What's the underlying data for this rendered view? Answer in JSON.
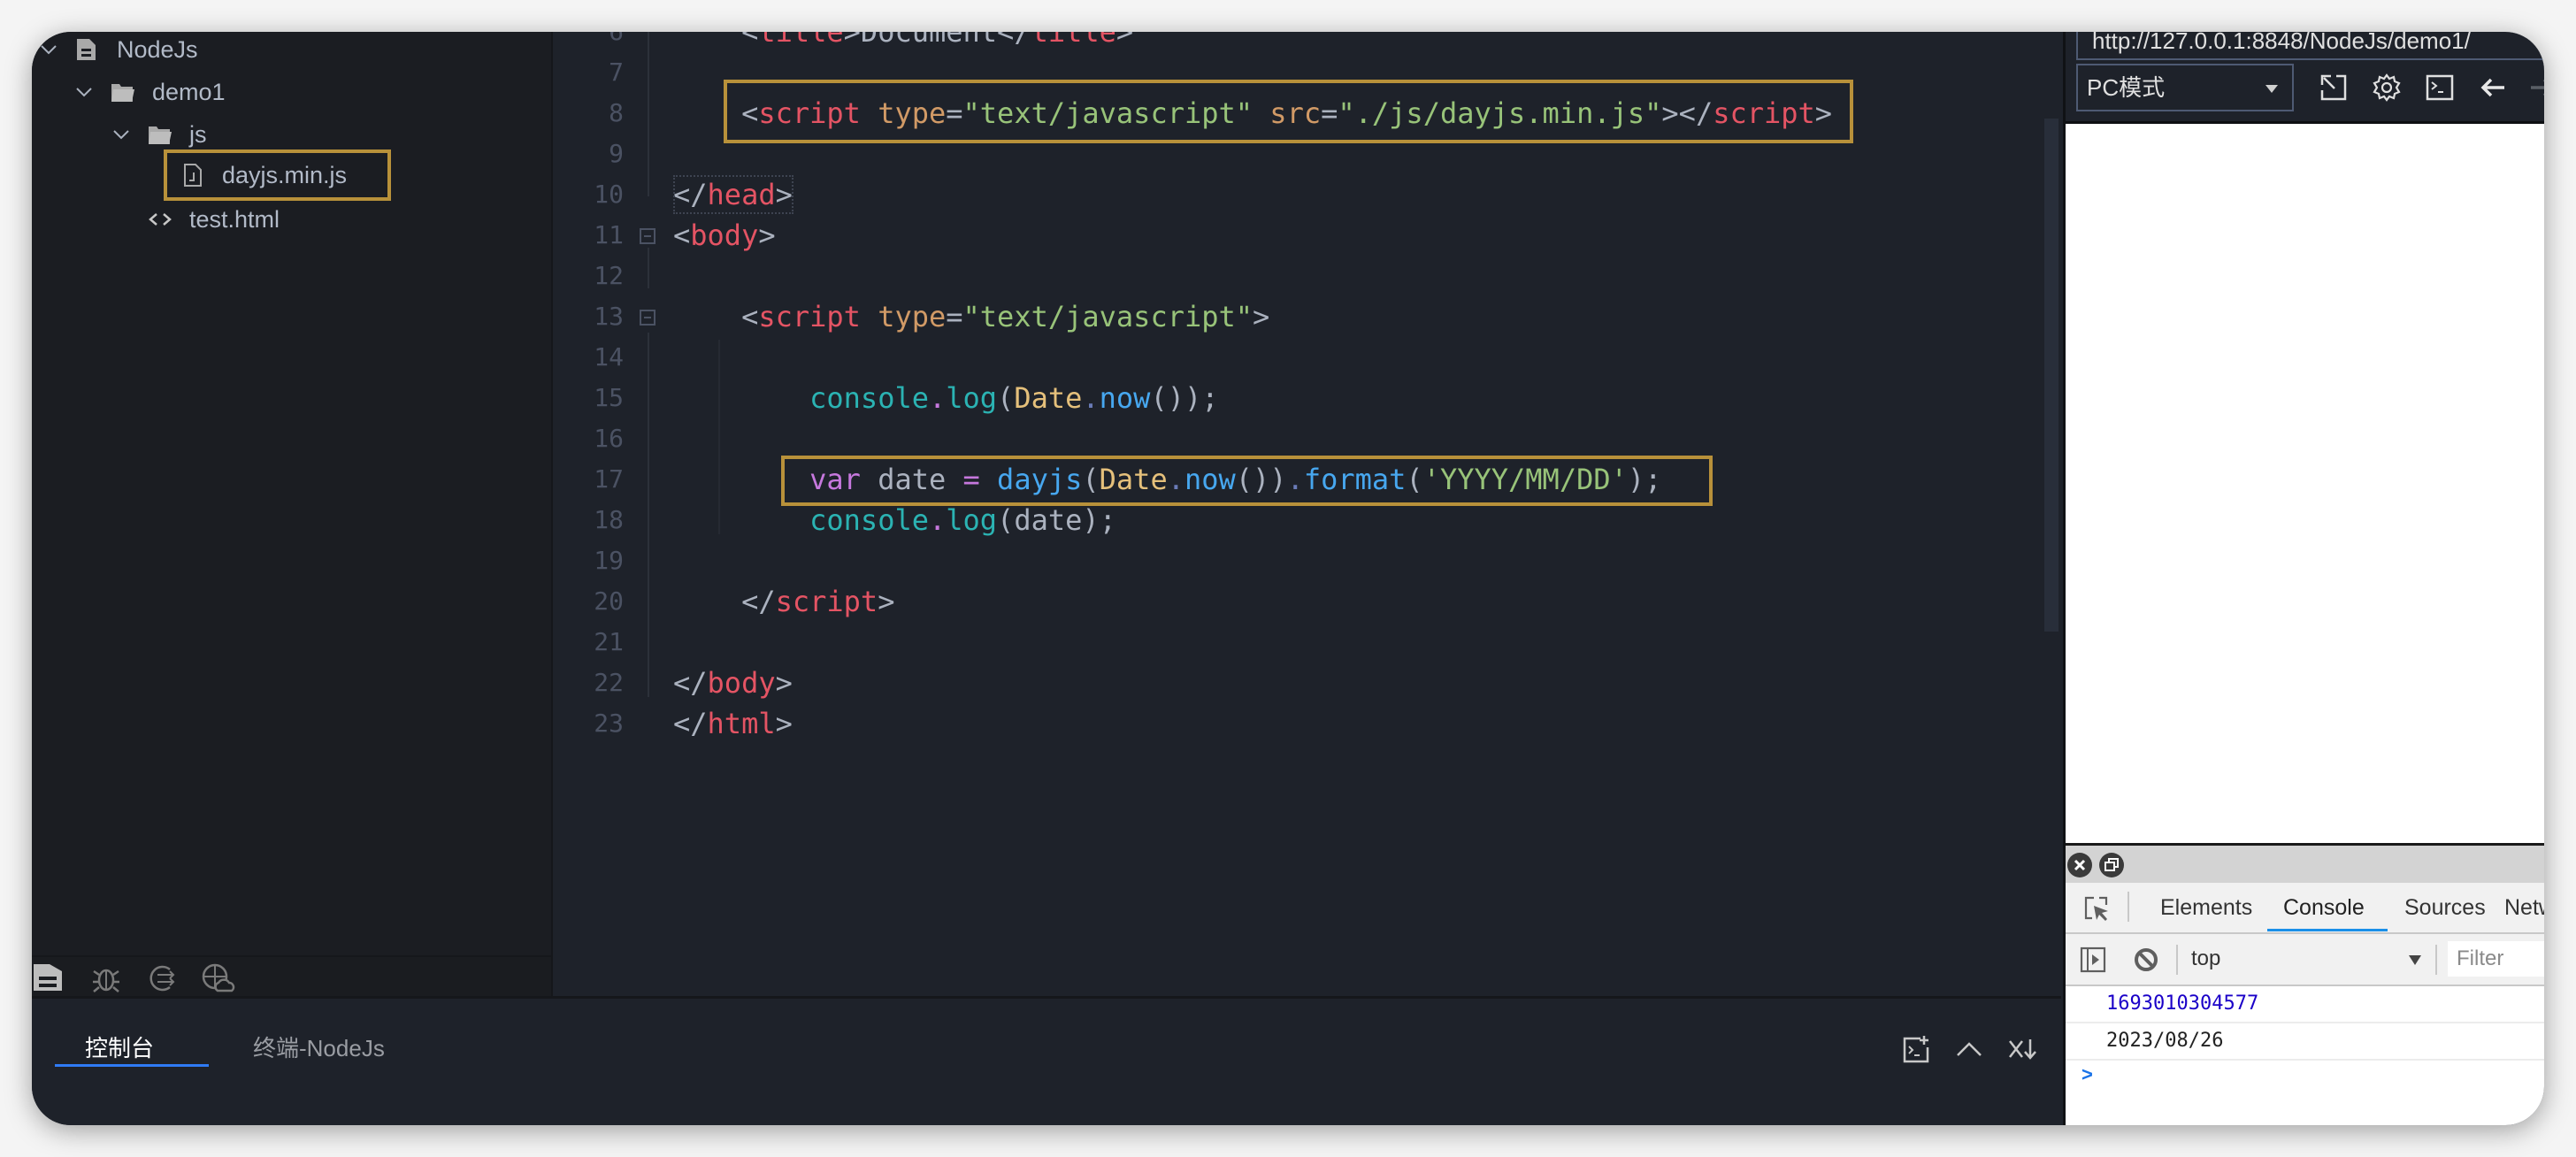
{
  "explorer": {
    "items": [
      {
        "label": "NodeJs",
        "type": "project",
        "expanded": true
      },
      {
        "label": "demo1",
        "type": "folder",
        "expanded": true
      },
      {
        "label": "js",
        "type": "folder",
        "expanded": true
      },
      {
        "label": "dayjs.min.js",
        "type": "js-file",
        "highlighted": true
      },
      {
        "label": "test.html",
        "type": "html-file"
      }
    ],
    "bottom_icons": [
      "project-manager-icon",
      "debug-icon",
      "git-icon",
      "cloud-deploy-icon"
    ]
  },
  "editor": {
    "lines": [
      {
        "n": "6",
        "tokens": [
          [
            "t-pun",
            "    <"
          ],
          [
            "t-tag",
            "title"
          ],
          [
            "t-pun",
            ">Document</"
          ],
          [
            "t-tag",
            "title"
          ],
          [
            "t-pun",
            ">"
          ]
        ]
      },
      {
        "n": "7",
        "tokens": []
      },
      {
        "n": "8",
        "tokens": [
          [
            "t-pun",
            "    <"
          ],
          [
            "t-tag",
            "script"
          ],
          [
            "t-pun",
            " "
          ],
          [
            "t-attr",
            "type"
          ],
          [
            "t-pun",
            "="
          ],
          [
            "t-str",
            "\"text/javascript\""
          ],
          [
            "t-pun",
            " "
          ],
          [
            "t-attr",
            "src"
          ],
          [
            "t-pun",
            "="
          ],
          [
            "t-str",
            "\"./js/dayjs.min.js\""
          ],
          [
            "t-pun",
            "></"
          ],
          [
            "t-tag",
            "script"
          ],
          [
            "t-pun",
            ">"
          ]
        ]
      },
      {
        "n": "9",
        "tokens": []
      },
      {
        "n": "10",
        "tokens": [
          [
            "t-pun",
            "</"
          ],
          [
            "t-tag",
            "head"
          ],
          [
            "t-pun",
            ">"
          ]
        ]
      },
      {
        "n": "11",
        "tokens": [
          [
            "t-pun",
            "<"
          ],
          [
            "t-tag",
            "body"
          ],
          [
            "t-pun",
            ">"
          ]
        ]
      },
      {
        "n": "12",
        "tokens": []
      },
      {
        "n": "13",
        "tokens": [
          [
            "t-pun",
            "    <"
          ],
          [
            "t-tag",
            "script"
          ],
          [
            "t-pun",
            " "
          ],
          [
            "t-attr",
            "type"
          ],
          [
            "t-pun",
            "="
          ],
          [
            "t-str",
            "\"text/javascript\""
          ],
          [
            "t-pun",
            ">"
          ]
        ]
      },
      {
        "n": "14",
        "tokens": []
      },
      {
        "n": "15",
        "tokens": [
          [
            "t-pun",
            "        "
          ],
          [
            "t-obj",
            "console"
          ],
          [
            "t-dot",
            "."
          ],
          [
            "t-obj",
            "log"
          ],
          [
            "t-pun",
            "("
          ],
          [
            "t-cls",
            "Date"
          ],
          [
            "t-dot2",
            "."
          ],
          [
            "t-fn",
            "now"
          ],
          [
            "t-pun",
            "());"
          ]
        ]
      },
      {
        "n": "16",
        "tokens": []
      },
      {
        "n": "17",
        "tokens": [
          [
            "t-pun",
            "        "
          ],
          [
            "t-kw",
            "var"
          ],
          [
            "t-var",
            " date "
          ],
          [
            "t-op",
            "="
          ],
          [
            "t-pun",
            " "
          ],
          [
            "t-fn",
            "dayjs"
          ],
          [
            "t-pun",
            "("
          ],
          [
            "t-cls",
            "Date"
          ],
          [
            "t-dot2",
            "."
          ],
          [
            "t-fn",
            "now"
          ],
          [
            "t-pun",
            "())"
          ],
          [
            "t-dot2",
            "."
          ],
          [
            "t-fn",
            "format"
          ],
          [
            "t-pun",
            "("
          ],
          [
            "t-str",
            "'YYYY/MM/DD'"
          ],
          [
            "t-pun",
            ");"
          ]
        ]
      },
      {
        "n": "18",
        "tokens": [
          [
            "t-pun",
            "        "
          ],
          [
            "t-obj",
            "console"
          ],
          [
            "t-dot",
            "."
          ],
          [
            "t-obj",
            "log"
          ],
          [
            "t-pun",
            "(date);"
          ]
        ]
      },
      {
        "n": "19",
        "tokens": []
      },
      {
        "n": "20",
        "tokens": [
          [
            "t-pun",
            "    </"
          ],
          [
            "t-tag",
            "script"
          ],
          [
            "t-pun",
            ">"
          ]
        ]
      },
      {
        "n": "21",
        "tokens": []
      },
      {
        "n": "22",
        "tokens": [
          [
            "t-pun",
            "</"
          ],
          [
            "t-tag",
            "body"
          ],
          [
            "t-pun",
            ">"
          ]
        ]
      },
      {
        "n": "23",
        "tokens": [
          [
            "t-pun",
            "</"
          ],
          [
            "t-tag",
            "html"
          ],
          [
            "t-pun",
            ">"
          ]
        ]
      }
    ],
    "highlighted_lines": [
      "8",
      "17"
    ]
  },
  "bottom_panel": {
    "tabs": [
      {
        "label": "控制台",
        "active": true
      },
      {
        "label": "终端-NodeJs",
        "active": false
      }
    ],
    "icons": [
      "new-terminal-icon",
      "chevron-up-icon",
      "clear-scroll-icon"
    ]
  },
  "preview": {
    "url": "http://127.0.0.1:8848/NodeJs/demo1/",
    "mode_select": "PC模式",
    "toolbar_icons": [
      "expand-icon",
      "gear-icon",
      "terminal-icon",
      "back-arrow-icon",
      "forward-arrow-icon"
    ]
  },
  "devtools": {
    "tabs": [
      {
        "label": "Elements",
        "active": false
      },
      {
        "label": "Console",
        "active": true
      },
      {
        "label": "Sources",
        "active": false
      },
      {
        "label": "Network",
        "active": false
      }
    ],
    "context": "top",
    "filter_placeholder": "Filter",
    "console_output": [
      {
        "text": "1693010304577",
        "kind": "number"
      },
      {
        "text": "2023/08/26",
        "kind": "string"
      }
    ],
    "prompt": ">"
  },
  "colors": {
    "highlight_box": "#b8913a",
    "accent_blue": "#2f7bf5",
    "console_number": "#1a00c8"
  }
}
